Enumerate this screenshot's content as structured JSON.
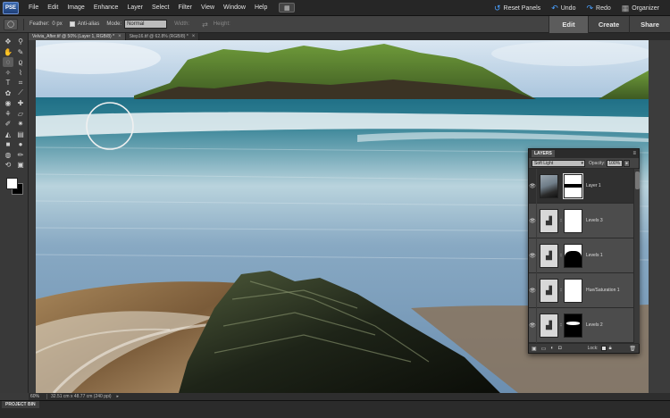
{
  "app": {
    "logo": "PSE",
    "menu": [
      "File",
      "Edit",
      "Image",
      "Enhance",
      "Layer",
      "Select",
      "Filter",
      "View",
      "Window",
      "Help"
    ],
    "reset_panels": "Reset Panels",
    "undo": "Undo",
    "redo": "Redo",
    "organizer": "Organizer"
  },
  "options": {
    "feather_label": "Feather:",
    "feather_value": "0 px",
    "anti_alias_label": "Anti-alias",
    "mode_label": "Mode:",
    "mode_value": "Normal",
    "width_label": "Width:",
    "height_label": "Height:"
  },
  "mode_tabs": [
    "Edit",
    "Create",
    "Share"
  ],
  "doc_tabs": [
    "Velvia_After.tif @ 50% (Layer 1, RGB/8) *",
    "Step16.tif @ 62.8% (RGB/8) *"
  ],
  "status": {
    "zoom": "60%",
    "info": "32.51 cm x 48.77 cm (240 ppi)"
  },
  "project_bin": "PROJECT BIN",
  "layers_panel": {
    "title": "LAYERS",
    "blend_mode": "Soft Light",
    "opacity_label": "Opacity:",
    "opacity_value": "100%",
    "layers": [
      {
        "name": "Layer 1"
      },
      {
        "name": "Levels 3"
      },
      {
        "name": "Levels 1"
      },
      {
        "name": "Hue/Saturation 1"
      },
      {
        "name": "Levels 2"
      }
    ],
    "lock_label": "Lock:"
  }
}
